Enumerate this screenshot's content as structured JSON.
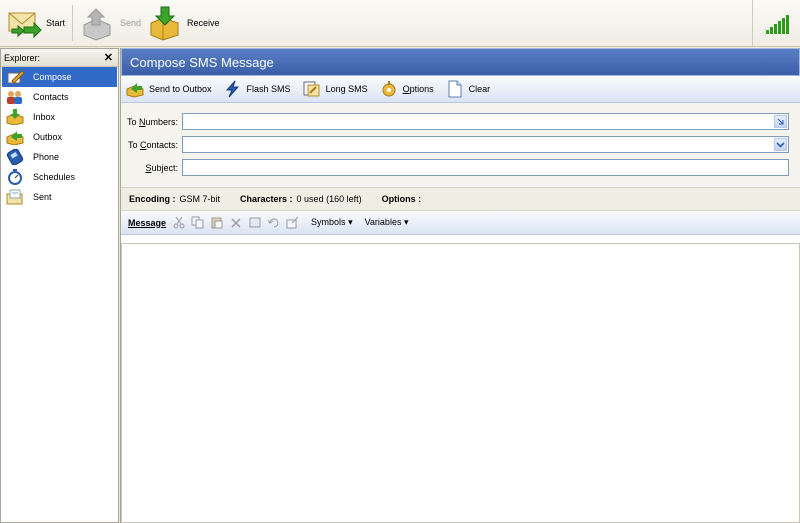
{
  "toolbar": {
    "start_label": "Start",
    "send_label": "Send",
    "receive_label": "Receive"
  },
  "explorer": {
    "title": "Explorer:",
    "close_glyph": "✕",
    "items": [
      {
        "label": "Compose",
        "icon": "compose-icon",
        "active": true
      },
      {
        "label": "Contacts",
        "icon": "contacts-icon"
      },
      {
        "label": "Inbox",
        "icon": "inbox-icon"
      },
      {
        "label": "Outbox",
        "icon": "outbox-icon"
      },
      {
        "label": "Phone",
        "icon": "phone-icon"
      },
      {
        "label": "Schedules",
        "icon": "stopwatch-icon"
      },
      {
        "label": "Sent",
        "icon": "sent-icon"
      }
    ]
  },
  "compose": {
    "title": "Compose SMS Message",
    "commands": {
      "send_to_outbox": "Send to Outbox",
      "flash_sms": "Flash SMS",
      "long_sms": "Long SMS",
      "options": "Options",
      "clear": "Clear"
    },
    "fields": {
      "to_numbers_label": "To Numbers:",
      "to_numbers_value": "",
      "to_contacts_label": "To Contacts:",
      "to_contacts_value": "",
      "subject_label": "Subject:",
      "subject_value": ""
    },
    "status": {
      "encoding_label": "Encoding :",
      "encoding_value": "GSM 7-bit",
      "characters_label": "Characters :",
      "characters_value": "0 used (160 left)",
      "options_label": "Options :"
    },
    "message_toolbar": {
      "label": "Message",
      "symbols": "Symbols",
      "variables": "Variables"
    },
    "message_value": ""
  },
  "colors": {
    "title_bar": "#3a5fa8",
    "active_item": "#3169c6",
    "signal": "#2e9a1c"
  }
}
